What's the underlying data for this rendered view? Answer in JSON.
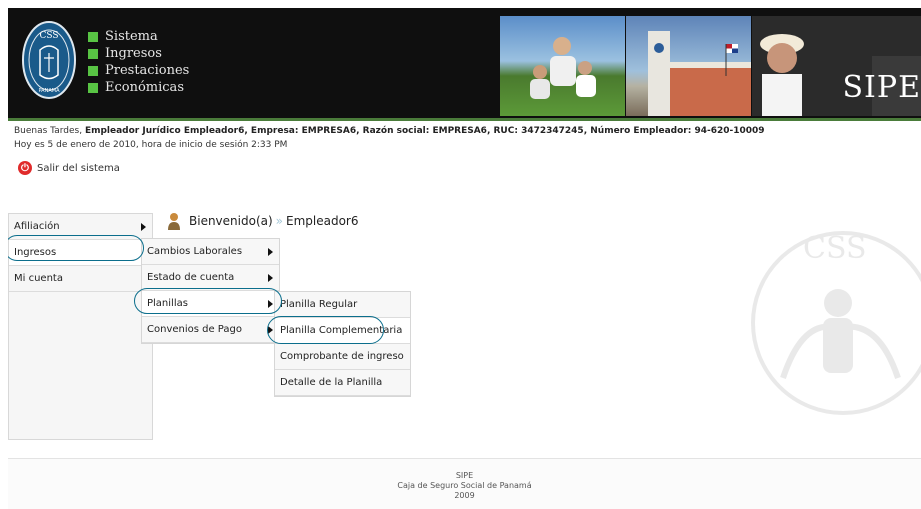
{
  "header": {
    "logo_text": "CSS PANAMA",
    "menu_titles": [
      "Sistema",
      "Ingresos",
      "Prestaciones",
      "Económicas"
    ],
    "brand": "SIPE",
    "accent_color": "#58c444"
  },
  "info": {
    "greeting": "Buenas Tardes,",
    "details": "Empleador Jurídico Empleador6, Empresa: EMPRESA6, Razón social: EMPRESA6, RUC: 3472347245, Número Empleador: 94-620-10009",
    "session": "Hoy es 5 de enero de 2010, hora de inicio de sesión 2:33 PM"
  },
  "logout": {
    "label": "Salir del sistema",
    "icon": "power-icon"
  },
  "welcome": {
    "label": "Bienvenido(a)",
    "sep": "»",
    "user": "Empleador6"
  },
  "menu_main": {
    "items": [
      {
        "label": "Afiliación",
        "has_sub": true
      },
      {
        "label": "Ingresos",
        "has_sub": true
      },
      {
        "label": "Mi cuenta",
        "has_sub": true
      }
    ]
  },
  "menu_ingresos": {
    "items": [
      {
        "label": "Cambios Laborales",
        "has_sub": true
      },
      {
        "label": "Estado de cuenta",
        "has_sub": true
      },
      {
        "label": "Planillas",
        "has_sub": true
      },
      {
        "label": "Convenios de Pago",
        "has_sub": true
      }
    ]
  },
  "menu_planillas": {
    "items": [
      {
        "label": "Planilla Regular"
      },
      {
        "label": "Planilla Complementaria"
      },
      {
        "label": "Comprobante de ingreso"
      },
      {
        "label": "Detalle de la Planilla"
      }
    ]
  },
  "footer": {
    "line1": "SIPE",
    "line2": "Caja de Seguro Social de Panamá",
    "line3": "2009"
  }
}
